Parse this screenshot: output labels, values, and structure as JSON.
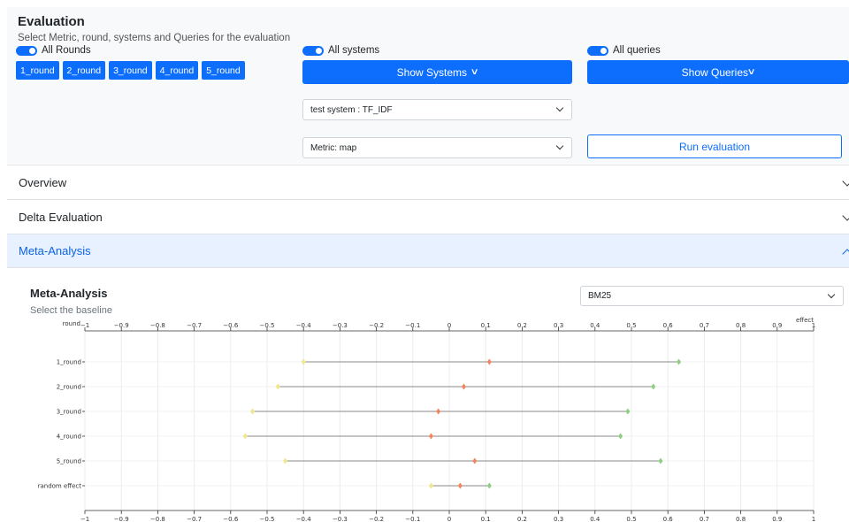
{
  "evaluation": {
    "title": "Evaluation",
    "subtitle": "Select Metric, round, systems and Queries for the evaluation",
    "all_rounds_label": "All Rounds",
    "rounds": [
      "1_round",
      "2_round",
      "3_round",
      "4_round",
      "5_round"
    ],
    "all_systems_label": "All systems",
    "show_systems_label": "Show Systems",
    "all_queries_label": "All queries",
    "show_queries_label": "Show Queries",
    "system_select": "test system : TF_IDF",
    "metric_select": "Metric: map",
    "run_label": "Run evaluation"
  },
  "accordion": [
    {
      "label": "Overview",
      "expanded": false
    },
    {
      "label": "Delta Evaluation",
      "expanded": false
    },
    {
      "label": "Meta-Analysis",
      "expanded": true
    }
  ],
  "meta": {
    "title": "Meta-Analysis",
    "subtitle": "Select the baseline",
    "baseline": "BM25"
  },
  "colors": {
    "accent": "#0d6efd",
    "lower": "#f0e68c",
    "estimate": "#f4845f",
    "upper": "#8fce80",
    "whisker": "#888888"
  },
  "chart_data": {
    "type": "forest",
    "ylabel": "round",
    "xlabel": "effect",
    "xlim": [
      -1,
      1
    ],
    "xticks": [
      "−1",
      "−0.9",
      "−0.8",
      "−0.7",
      "−0.6",
      "−0.5",
      "−0.4",
      "−0.3",
      "−0.2",
      "−0.1",
      "0",
      "0.1",
      "0.2",
      "0.3",
      "0.4",
      "0.5",
      "0.6",
      "0.7",
      "0.8",
      "0.9",
      "1"
    ],
    "grid": true,
    "rows": [
      {
        "label": "1_round",
        "lower": -0.4,
        "estimate": 0.11,
        "upper": 0.63
      },
      {
        "label": "2_round",
        "lower": -0.47,
        "estimate": 0.04,
        "upper": 0.56
      },
      {
        "label": "3_round",
        "lower": -0.54,
        "estimate": -0.03,
        "upper": 0.49
      },
      {
        "label": "4_round",
        "lower": -0.56,
        "estimate": -0.05,
        "upper": 0.47
      },
      {
        "label": "5_round",
        "lower": -0.45,
        "estimate": 0.07,
        "upper": 0.58
      },
      {
        "label": "random effect",
        "lower": -0.05,
        "estimate": 0.03,
        "upper": 0.11
      }
    ]
  }
}
